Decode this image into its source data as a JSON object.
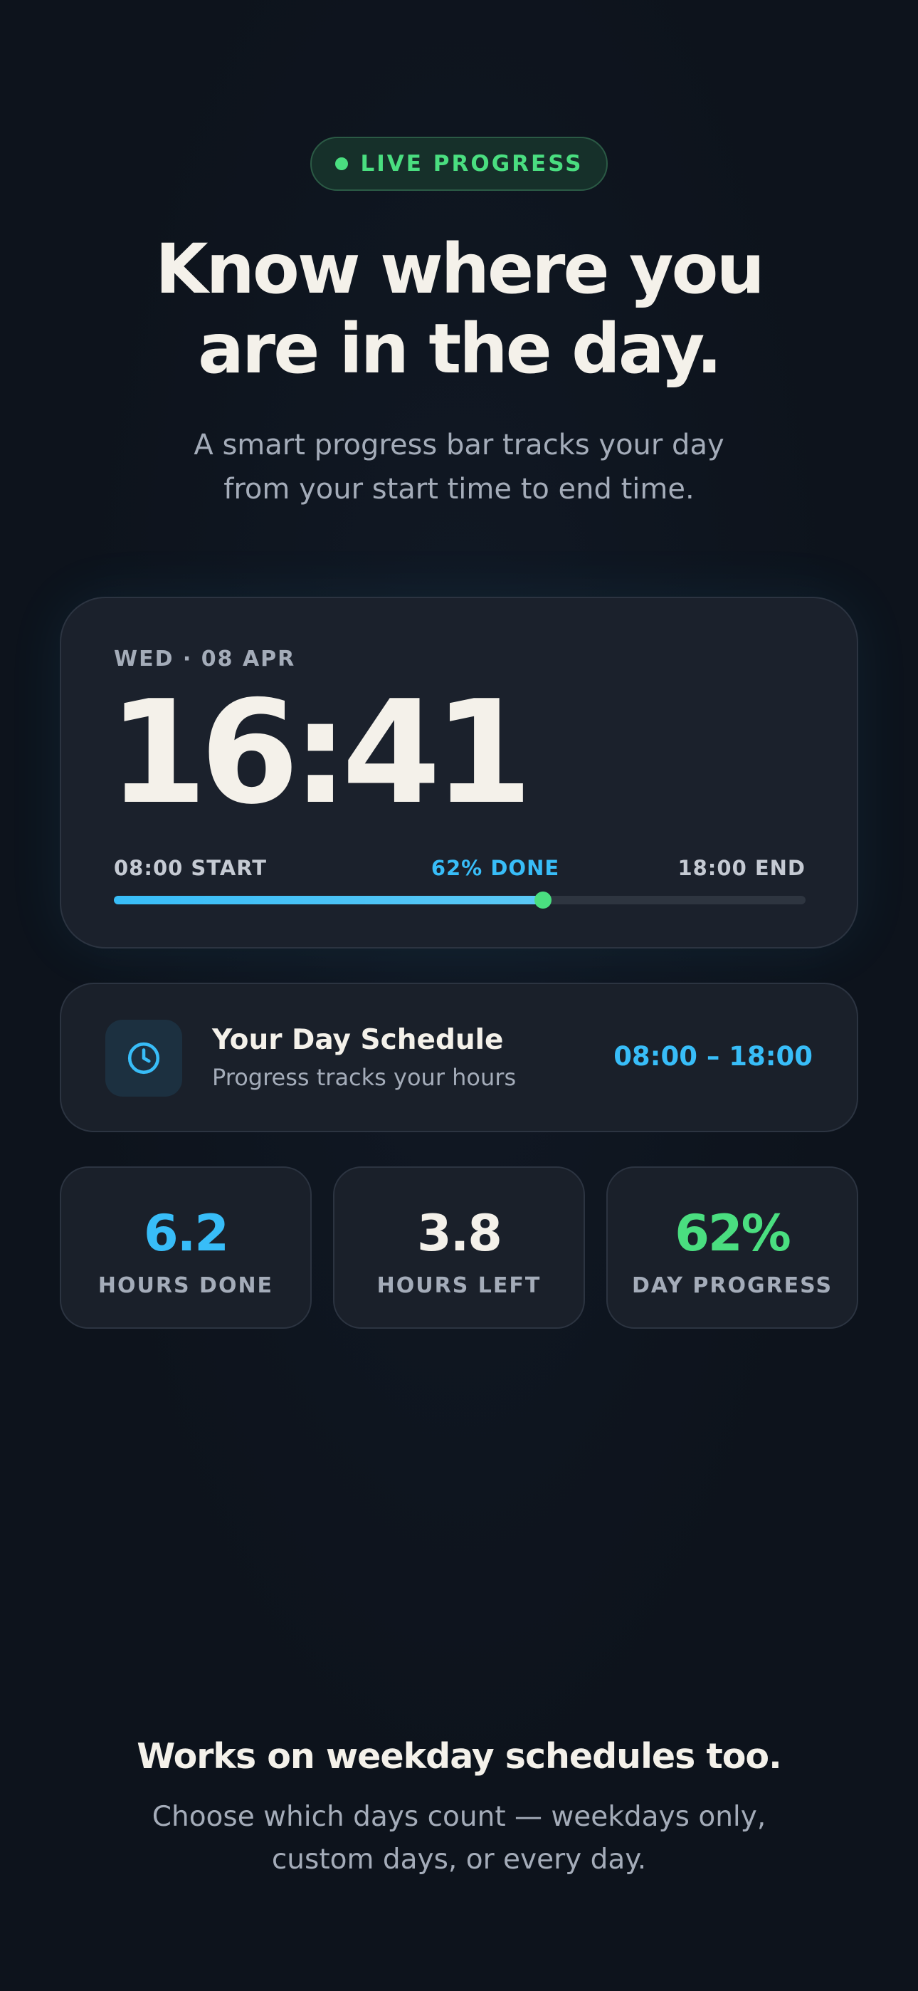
{
  "badge": {
    "label": "LIVE PROGRESS",
    "color": "#4ade80"
  },
  "hero": {
    "title_line1": "Know where you",
    "title_line2": "are in the day.",
    "subtitle_line1": "A smart progress bar tracks your day",
    "subtitle_line2": "from your start time to end time."
  },
  "clock": {
    "date": "WED · 08 APR",
    "time": "16:41",
    "start_label": "08:00 START",
    "progress_label": "62% DONE",
    "end_label": "18:00 END",
    "progress": 0.62,
    "accent": "#38bdf8",
    "knob_color": "#4ade80"
  },
  "schedule": {
    "icon": "clock-icon",
    "title": "Your Day Schedule",
    "subtitle": "Progress tracks your hours",
    "range": "08:00 – 18:00"
  },
  "stats": [
    {
      "value": "6.2",
      "label": "HOURS DONE",
      "color": "#38bdf8"
    },
    {
      "value": "3.8",
      "label": "HOURS LEFT",
      "color": "#f4f1ea"
    },
    {
      "value": "62%",
      "label": "DAY PROGRESS",
      "color": "#4ade80"
    }
  ],
  "footer": {
    "title": "Works on weekday schedules too.",
    "subtitle_line1": "Choose which days count — weekdays only,",
    "subtitle_line2": "custom days, or every day."
  }
}
